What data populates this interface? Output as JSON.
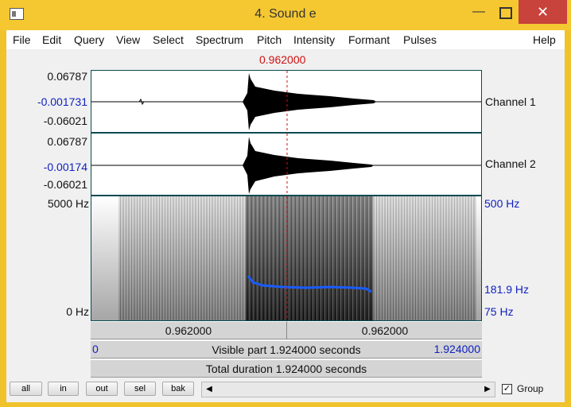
{
  "window": {
    "title": "4. Sound e",
    "minimize": "—",
    "close": "✕"
  },
  "menu": [
    "File",
    "Edit",
    "Query",
    "View",
    "Select",
    "Spectrum",
    "Pitch",
    "Intensity",
    "Formant",
    "Pulses",
    "Help"
  ],
  "cursor_time": "0.962000",
  "channel1": {
    "label": "Channel 1",
    "max": "0.06787",
    "mean": "-0.001731",
    "min": "-0.06021"
  },
  "channel2": {
    "label": "Channel 2",
    "max": "0.06787",
    "mean": "-0.00174",
    "min": "-0.06021"
  },
  "spectrogram": {
    "freq_top": "5000 Hz",
    "freq_bottom": "0 Hz",
    "pitch_top": "500 Hz",
    "pitch_value": "181.9 Hz",
    "pitch_bottom": "75 Hz"
  },
  "time_bar": {
    "left": "0.962000",
    "right": "0.962000"
  },
  "visible": {
    "start": "0",
    "text": "Visible part 1.924000 seconds",
    "end": "1.924000"
  },
  "total": "Total duration 1.924000 seconds",
  "toolbar": {
    "buttons": [
      "all",
      "in",
      "out",
      "sel",
      "bak"
    ],
    "scroll_left": "◀",
    "scroll_right": "▶",
    "group_label": "Group",
    "group_checked": "✓"
  },
  "colors": {
    "title_bar": "#f5c832",
    "close_button": "#c7433b",
    "cursor": "#d01010",
    "pitch": "#1a5cff",
    "axis_blue": "#1020c0"
  }
}
